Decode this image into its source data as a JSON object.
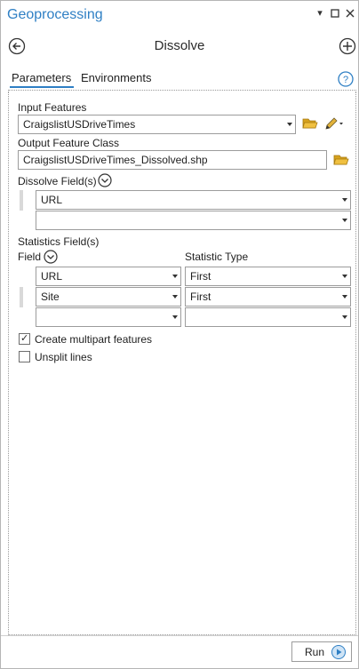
{
  "window": {
    "title": "Geoprocessing"
  },
  "tool": {
    "name": "Dissolve"
  },
  "tabs": {
    "parameters": "Parameters",
    "environments": "Environments"
  },
  "input_features": {
    "label": "Input Features",
    "value": "CraigslistUSDriveTimes"
  },
  "output_feature_class": {
    "label": "Output Feature Class",
    "value": "CraigslistUSDriveTimes_Dissolved.shp"
  },
  "dissolve_fields": {
    "label": "Dissolve Field(s)",
    "rows": [
      "URL",
      ""
    ]
  },
  "statistics_fields": {
    "label": "Statistics Field(s)",
    "field_header": "Field",
    "type_header": "Statistic Type",
    "rows": [
      {
        "field": "URL",
        "type": "First"
      },
      {
        "field": "Site",
        "type": "First"
      },
      {
        "field": "",
        "type": ""
      }
    ]
  },
  "options": {
    "multipart": {
      "label": "Create multipart features",
      "checked": true
    },
    "unsplit": {
      "label": "Unsplit lines",
      "checked": false
    }
  },
  "run_button": {
    "label": "Run"
  },
  "colors": {
    "accent": "#2e7fc4",
    "folder": "#d6a21e"
  }
}
